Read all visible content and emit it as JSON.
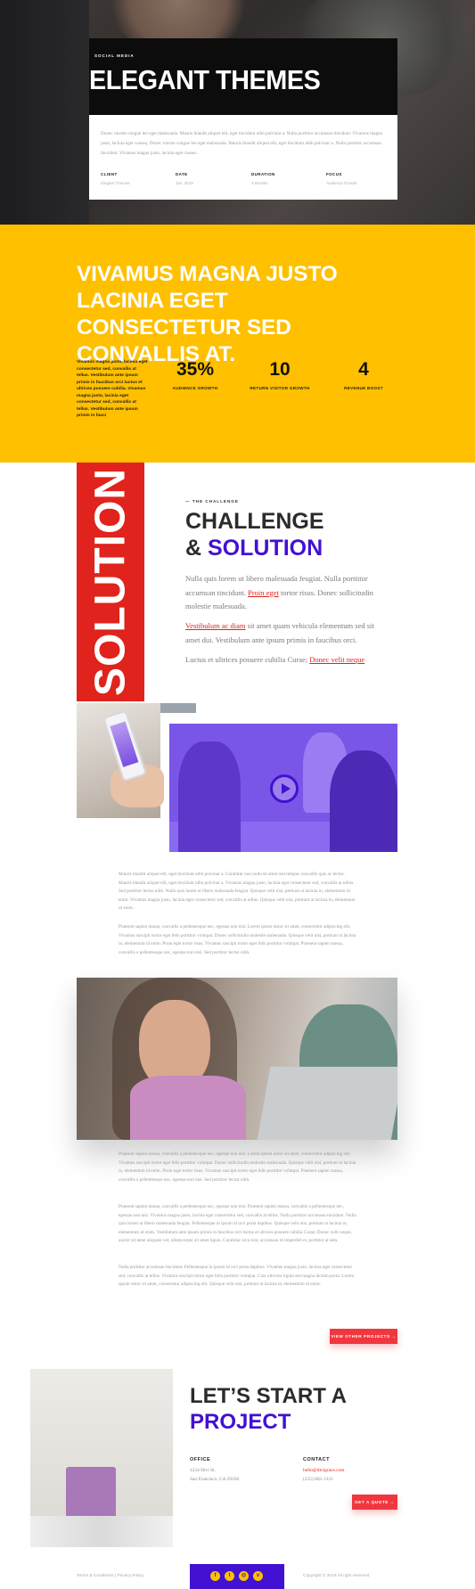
{
  "hero": {
    "kicker": "SOCIAL MEDIA",
    "title": "ELEGANT THEMES",
    "description": "Donec rutrum congue leo eget malesuada. Mauris blandit aliquet elit, eget tincidunt nibh pulvinar a. Nulla porttitor accumsan tincidunt. Vivamus magna justo, lacinia eget conseq. Donec rutrum congue leo eget malesuada. Mauris blandit aliquet elit, eget tincidunt nibh pulvinar a. Nulla porttitor accumsan tincidunt. Vivamus magna justo, lacinia eget consec.",
    "meta": [
      {
        "label": "CLIENT",
        "value": "Elegant Themes"
      },
      {
        "label": "DATE",
        "value": "Jan, 2019"
      },
      {
        "label": "DURATION",
        "value": "3 Months"
      },
      {
        "label": "FOCUS",
        "value": "Audience Growth"
      }
    ]
  },
  "stats_section": {
    "heading": "VIVAMUS MAGNA JUSTO LACINIA EGET CONSECTETUR SED CONVALLIS AT.",
    "intro": "Vivamus magna justo, lacinia eget consectetur sed, convallis at tellus. Vestibulum ante ipsum primis in faucibus orci luctus et ultrices posuere cubilia. Vivamus magna justo, lacinia eget consectetur sed, convallis at tellus. Vestibulum ante ipsum primis in fauci",
    "stats": [
      {
        "number": "35%",
        "label": "AUDIENCE GROWTH"
      },
      {
        "number": "10",
        "label": "RETURN VISITOR GROWTH"
      },
      {
        "number": "4",
        "label": "REVENUE BOOST"
      }
    ]
  },
  "challenge": {
    "side_word": "SOLUTION",
    "kicker": "— THE CHALLENGE",
    "title_line1": "CHALLENGE",
    "title_amp": "& ",
    "title_accent": "SOLUTION",
    "p1_text": "Nulla quis lorem ut libero malesuada feugiat. Nulla porttitor accumsan tincidunt. Proin eget tortor risus. ",
    "p1_link": "Proin eget",
    "p1_tail": " tortor risus. Donec sollicitudin molestie malesuada.",
    "p2_link": "Vestibulum ac diam",
    "p2_text": " sit amet quam vehicula elementum sed sit amet dui. Vestibulum ante ipsum primis in faucibus orci.",
    "p3_text": "Luctus et ultrices posuere cubilia Curae; ",
    "p3_link": "Donec velit neque"
  },
  "body_text": {
    "p1": "Mauris blandit aliquet elit, eget tincidunt nibh pulvinar a. Curabitur non nulla sit amet nisl tempus convallis quis ac lectus. Mauris blandit aliquet elit, eget tincidunt nibh pulvinar a. Vivamus magna justo, lacinia eget consectetur sed, convallis at tellus. Sed porttitor lectus nibh. Nulla quis lorem ut libero malesuada feugiat. Quisque velit nisi, pretium ut lacinia in, elementum id enim. Vivamus magna justo, lacinia eget consectetur sed, convallis at tellus. Quisque velit nisi, pretium ut lacinia in, elementum id enim.",
    "p2": "Praesent sapien massa, convallis a pellentesque nec, egestas non nisi. Lorem ipsum dolor sit amet, consectetur adipiscing elit. Vivamus suscipit tortor eget felis porttitor volutpat. Donec sollicitudin molestie malesuada. Quisque velit nisi, pretium ut lacinia in, elementum id enim. Proin eget tortor risus. Vivamus suscipit tortor eget felis porttitor volutpat. Praesent sapien massa, convallis a pellentesque nec, egestas non nisi. Sed porttitor lectus nibh.",
    "p3": "Praesent sapien massa, convallis a pellentesque nec, egestas non nisi. Lorem ipsum dolor sit amet, consectetur adipiscing elit. Vivamus suscipit tortor eget felis porttitor volutpat. Donec sollicitudin molestie malesuada. Quisque velit nisi, pretium ut lacinia in, elementum id enim. Proin eget tortor risus. Vivamus suscipit tortor eget felis porttitor volutpat. Praesent sapien massa, convallis a pellentesque nec, egestas non nisi. Sed porttitor lectus nibh.",
    "p4": "Praesent sapien massa, convallis a pellentesque nec, egestas non nisi. Praesent sapien massa, convallis a pellentesque nec, egestas non nisi. Vivamus magna justo, lacinia eget consectetur sed, convallis at tellus. Nulla porttitor accumsan tincidunt. Nulla quis lorem ut libero malesuada feugiat. Pellentesque in ipsum id orci porta dapibus. Quisque velit nisi, pretium ut lacinia in, elementum id enim. Vestibulum ante ipsum primis in faucibus orci luctus et ultrices posuere cubilia Curae; Donec velit neque, auctor sit amet aliquam vel, ullamcorper sit amet ligula. Curabitur arcu erat, accumsan id imperdiet et, porttitor at sem.",
    "p5": "Nulla porttitor accumsan tincidunt. Pellentesque in ipsum id orci porta dapibus. Vivamus magna justo, lacinia eget consectetur sed, convallis at tellus. Vivamus suscipit tortor eget felis porttitor volutpat. Cras ultricies ligula sed magna dictum porta. Lorem ipsum dolor sit amet, consectetur adipiscing elit. Quisque velit nisi, pretium ut lacinia in, elementum id enim."
  },
  "view_projects_label": "VIEW OTHER PROJECTS →",
  "contact": {
    "title_line1": "LET’S START A",
    "title_accent": "PROJECT",
    "office_label": "OFFICE",
    "office_line1": "1234 Divi St.",
    "office_line2": "San Francisco, CA 29358",
    "contact_label": "CONTACT",
    "email": "hello@divigrace.com",
    "phone": "(255) 862-1331",
    "quote_label": "GET A QUOTE →"
  },
  "footer": {
    "links": "Terms & Conditions | Privacy Policy",
    "copyright": "Copyright © 2019 All right reserved",
    "social": [
      "f",
      "t",
      "◎",
      "v"
    ]
  }
}
